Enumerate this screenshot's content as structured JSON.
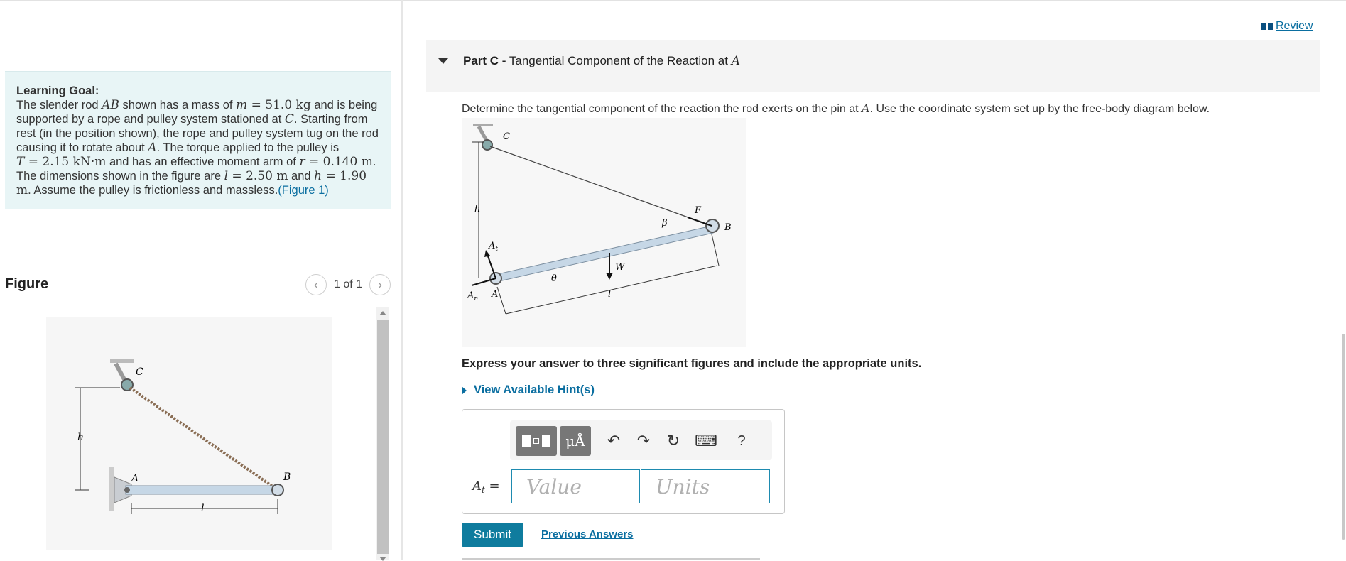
{
  "header": {
    "review_label": "Review"
  },
  "learning_goal": {
    "title": "Learning Goal:",
    "text_1": "The slender rod ",
    "rod": "AB",
    "text_2": " shown has a mass of ",
    "m_var": "m",
    "m_eq": " = 51.0 kg",
    "text_3": " and is being supported by a rope and pulley system stationed at ",
    "C": "C",
    "text_4": ". Starting from rest (in the position shown), the rope and pulley system tug on the rod causing it to rotate about ",
    "A": "A",
    "text_5": ". The torque applied to the pulley is ",
    "T_var": "T",
    "T_eq": " = 2.15 kN·m",
    "text_6": " and has an effective moment arm of ",
    "r_var": "r",
    "r_eq": " = 0.140 m",
    "text_7": ". The dimensions shown in the figure are ",
    "l_var": "l",
    "l_eq": " = 2.50 m",
    "text_8": " and ",
    "h_var": "h",
    "h_eq": " = 1.90 m",
    "text_9": ". Assume the pulley is frictionless and massless.",
    "figure_link": "(Figure 1)"
  },
  "figure_panel": {
    "title": "Figure",
    "pager": "1 of 1",
    "prev_icon": "‹",
    "next_icon": "›",
    "labels": {
      "C": "C",
      "h": "h",
      "A": "A",
      "B": "B",
      "l": "l"
    }
  },
  "part": {
    "prefix": "Part C -",
    "title": " Tangential Component of the Reaction at ",
    "point": "A",
    "question_1": "Determine the tangential component of the reaction the rod exerts on the pin at ",
    "question_point": "A",
    "question_2": ". Use the coordinate system set up by the free-body diagram below.",
    "diagram_labels": {
      "C": "C",
      "h": "h",
      "At": "A",
      "At_sub": "t",
      "An": "A",
      "An_sub": "n",
      "A": "A",
      "theta": "θ",
      "W": "W",
      "l": "l",
      "beta": "β",
      "F": "F",
      "B": "B"
    },
    "instruction": "Express your answer to three significant figures and include the appropriate units.",
    "hint_label": "View Available Hint(s)"
  },
  "answer": {
    "label": "A",
    "label_sub": "t",
    "equals": " =",
    "value_placeholder": "Value",
    "units_placeholder": "Units",
    "toolbar": {
      "units_symbol": "μÅ",
      "undo": "↶",
      "redo": "↷",
      "reset": "↻",
      "keyboard": "⌨",
      "help": "?"
    }
  },
  "actions": {
    "submit_label": "Submit",
    "previous_answers_label": "Previous Answers"
  }
}
